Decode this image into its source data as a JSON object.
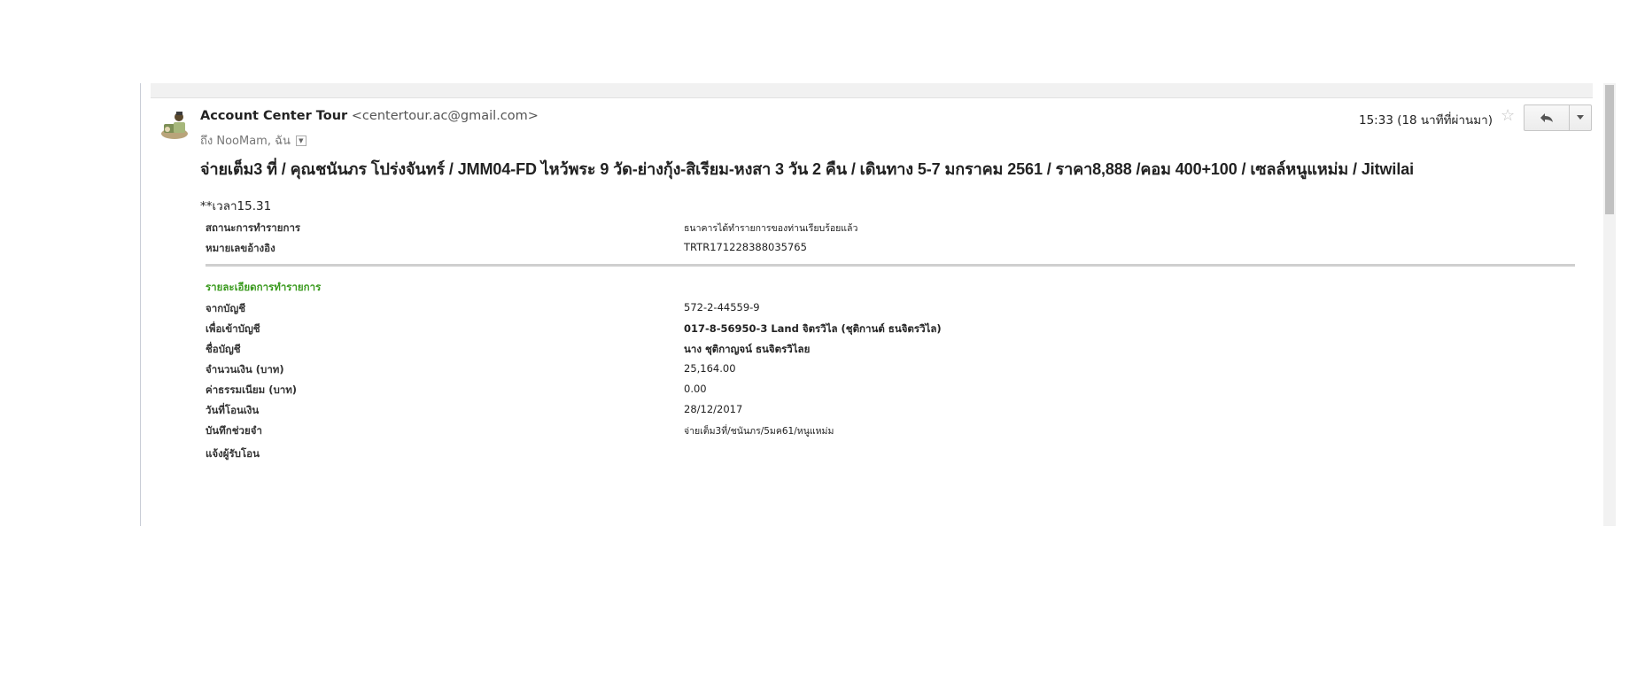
{
  "email": {
    "sender_name": "Account Center Tour",
    "sender_email": "<centertour.ac@gmail.com>",
    "to_line": "ถึง NooMam, ฉัน",
    "time": "15:33 (18 นาทีที่ผ่านมา)",
    "subject": "จ่ายเต็ม3 ที่ / คุณชนันภร โปร่งจันทร์ / JMM04-FD ไหว้พระ 9 วัด-ย่างกุ้ง-สิเรียม-หงสา 3 วัน 2 คืน / เดินทาง 5-7 มกราคม 2561 / ราคา8,888 /คอม 400+100 / เซลล์หนูแหม่ม / Jitwilai",
    "note": "**เวลา15.31"
  },
  "status_rows": [
    {
      "label": "สถานะการทำรายการ",
      "value": "ธนาคารได้ทำรายการของท่านเรียบร้อยแล้ว"
    },
    {
      "label": "หมายเลขอ้างอิง",
      "value": "TRTR171228388035765"
    }
  ],
  "details_title": "รายละเอียดการทำรายการ",
  "detail_rows": [
    {
      "label": "จากบัญชี",
      "value": "572-2-44559-9"
    },
    {
      "label": "เพื่อเข้าบัญชี",
      "value": "017-8-56950-3 Land จิตรวิไล (ชุติกานต์ ธนจิตรวิไล)"
    },
    {
      "label": "ชื่อบัญชี",
      "value": "นาง ชุติกาญจน์ ธนจิตรวิไลย"
    },
    {
      "label": "จำนวนเงิน (บาท)",
      "value": "25,164.00"
    },
    {
      "label": "ค่าธรรมเนียม (บาท)",
      "value": "0.00"
    },
    {
      "label": "วันที่โอนเงิน",
      "value": "28/12/2017"
    },
    {
      "label": "บันทึกช่วยจำ",
      "value": "จ่ายเต็ม3ที่/ชนันภร/5มค61/หนูแหม่ม"
    },
    {
      "label": "แจ้งผู้รับโอน",
      "value": ""
    }
  ],
  "icons": {
    "star": "star-icon",
    "reply": "reply-icon",
    "more": "chevron-down-icon",
    "avatar": "avatar-icon"
  }
}
